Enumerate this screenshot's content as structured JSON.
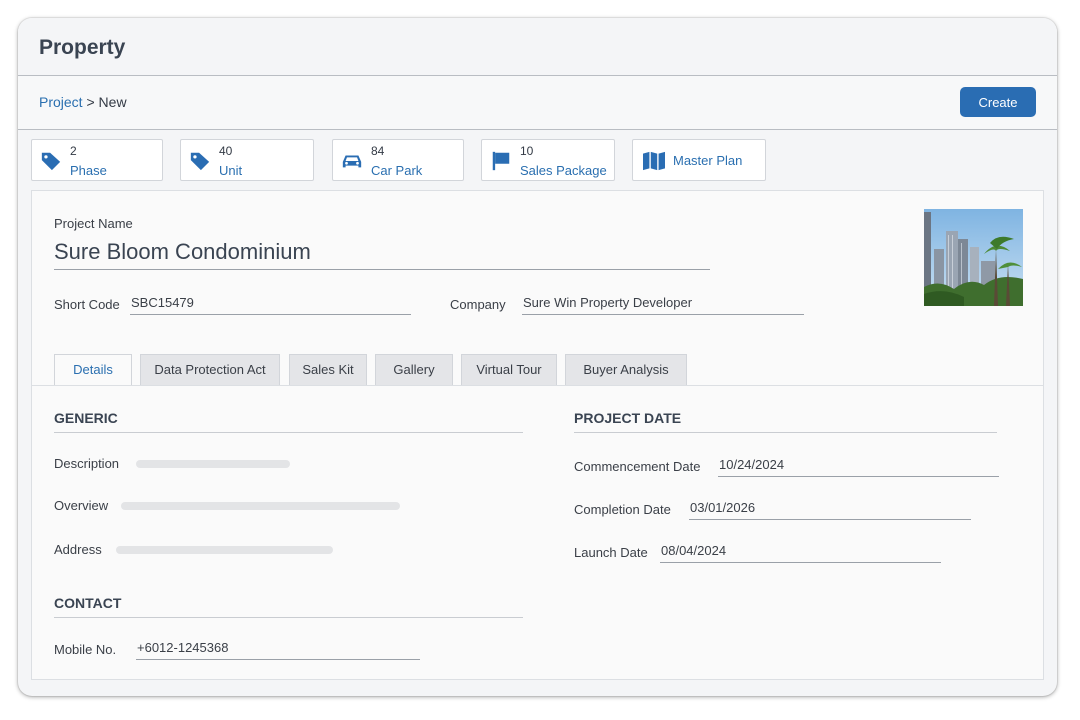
{
  "header": {
    "title": "Property"
  },
  "breadcrumb": {
    "parent": "Project",
    "separator": " > ",
    "current": "New"
  },
  "actions": {
    "create_label": "Create"
  },
  "stats": [
    {
      "icon": "tag-icon",
      "count": "2",
      "label": "Phase"
    },
    {
      "icon": "tag-icon",
      "count": "40",
      "label": "Unit"
    },
    {
      "icon": "car-icon",
      "count": "84",
      "label": "Car Park"
    },
    {
      "icon": "flag-icon",
      "count": "10",
      "label": "Sales Package"
    },
    {
      "icon": "map-icon",
      "count": "",
      "label": "Master Plan"
    }
  ],
  "project": {
    "name_label": "Project Name",
    "name": "Sure Bloom Condominium",
    "short_code_label": "Short Code",
    "short_code": "SBC15479",
    "company_label": "Company",
    "company": "Sure Win Property Developer"
  },
  "tabs": [
    {
      "label": "Details",
      "active": true
    },
    {
      "label": "Data Protection Act",
      "active": false
    },
    {
      "label": "Sales Kit",
      "active": false
    },
    {
      "label": "Gallery",
      "active": false
    },
    {
      "label": "Virtual Tour",
      "active": false
    },
    {
      "label": "Buyer Analysis",
      "active": false
    }
  ],
  "generic": {
    "heading": "GENERIC",
    "description_label": "Description",
    "overview_label": "Overview",
    "address_label": "Address"
  },
  "contact": {
    "heading": "CONTACT",
    "mobile_label": "Mobile No.",
    "mobile": "+6012-1245368"
  },
  "project_date": {
    "heading": "PROJECT DATE",
    "commencement_label": "Commencement Date",
    "commencement": "10/24/2024",
    "completion_label": "Completion Date",
    "completion": "03/01/2026",
    "launch_label": "Launch Date",
    "launch": "08/04/2024"
  },
  "colors": {
    "accent": "#2a6db3",
    "link": "#2a6fb0"
  }
}
